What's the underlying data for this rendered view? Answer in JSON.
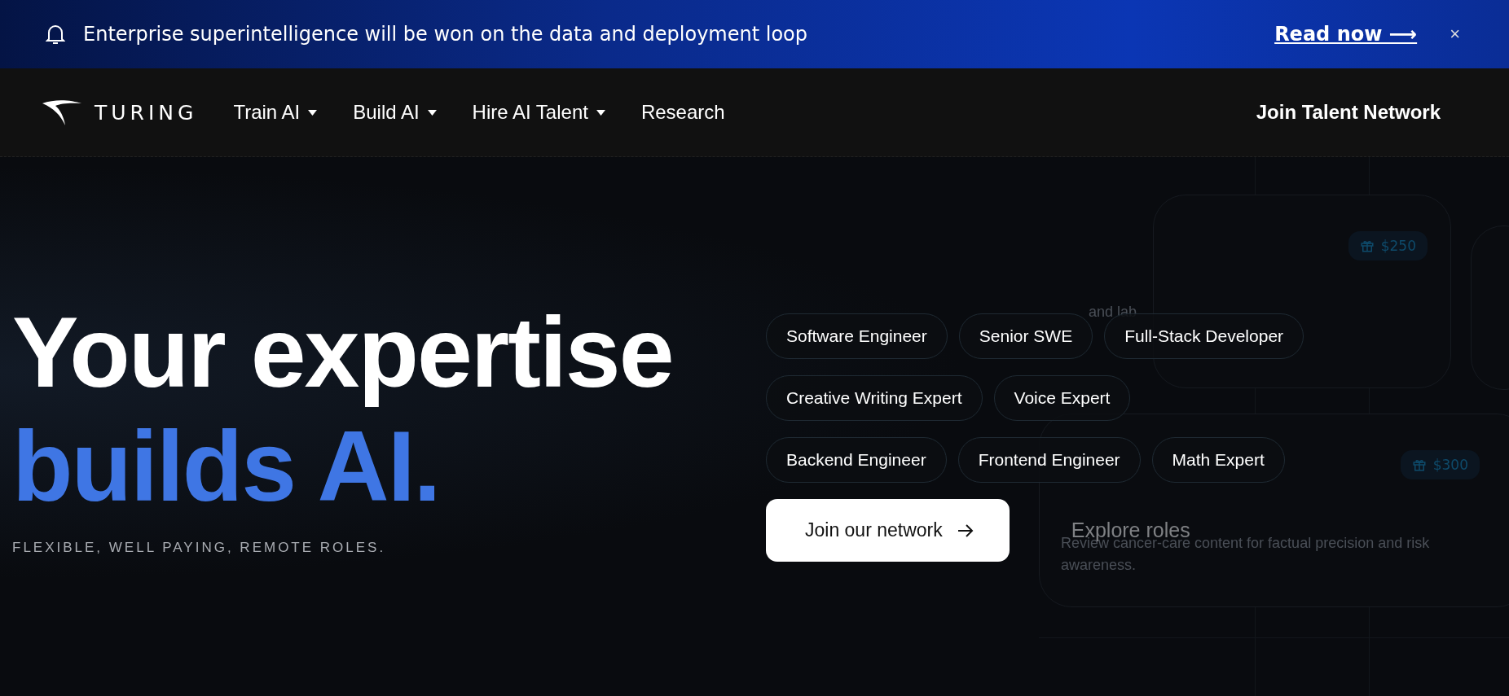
{
  "banner": {
    "text": "Enterprise superintelligence will be won on the data and deployment loop",
    "link": "Read now ⟶",
    "close": "×"
  },
  "nav": {
    "logo": "TURING",
    "items": [
      {
        "label": "Train AI",
        "kind": "dropdown"
      },
      {
        "label": "Build AI",
        "kind": "dropdown"
      },
      {
        "label": "Hire AI Talent",
        "kind": "dropdown"
      },
      {
        "label": "Research",
        "kind": "link"
      }
    ],
    "cta": "Join Talent Network"
  },
  "hero": {
    "title_line_1": "Your expertise",
    "title_line_2": "builds AI.",
    "subtitle": "FLEXIBLE, WELL PAYING, REMOTE ROLES.",
    "role_rows": [
      [
        "Software Engineer",
        "Senior SWE",
        "Full-Stack Developer"
      ],
      [
        "Creative Writing Expert",
        "Voice Expert"
      ],
      [
        "Backend Engineer",
        "Frontend Engineer",
        "Math Expert"
      ]
    ],
    "primary_button": "Join our network",
    "secondary_button": "Explore roles"
  },
  "background_cards": [
    {
      "reward": "$250",
      "text": "and lab"
    },
    {
      "reward": "$300",
      "text": "Review cancer-care content for factual precision and risk awareness."
    }
  ]
}
